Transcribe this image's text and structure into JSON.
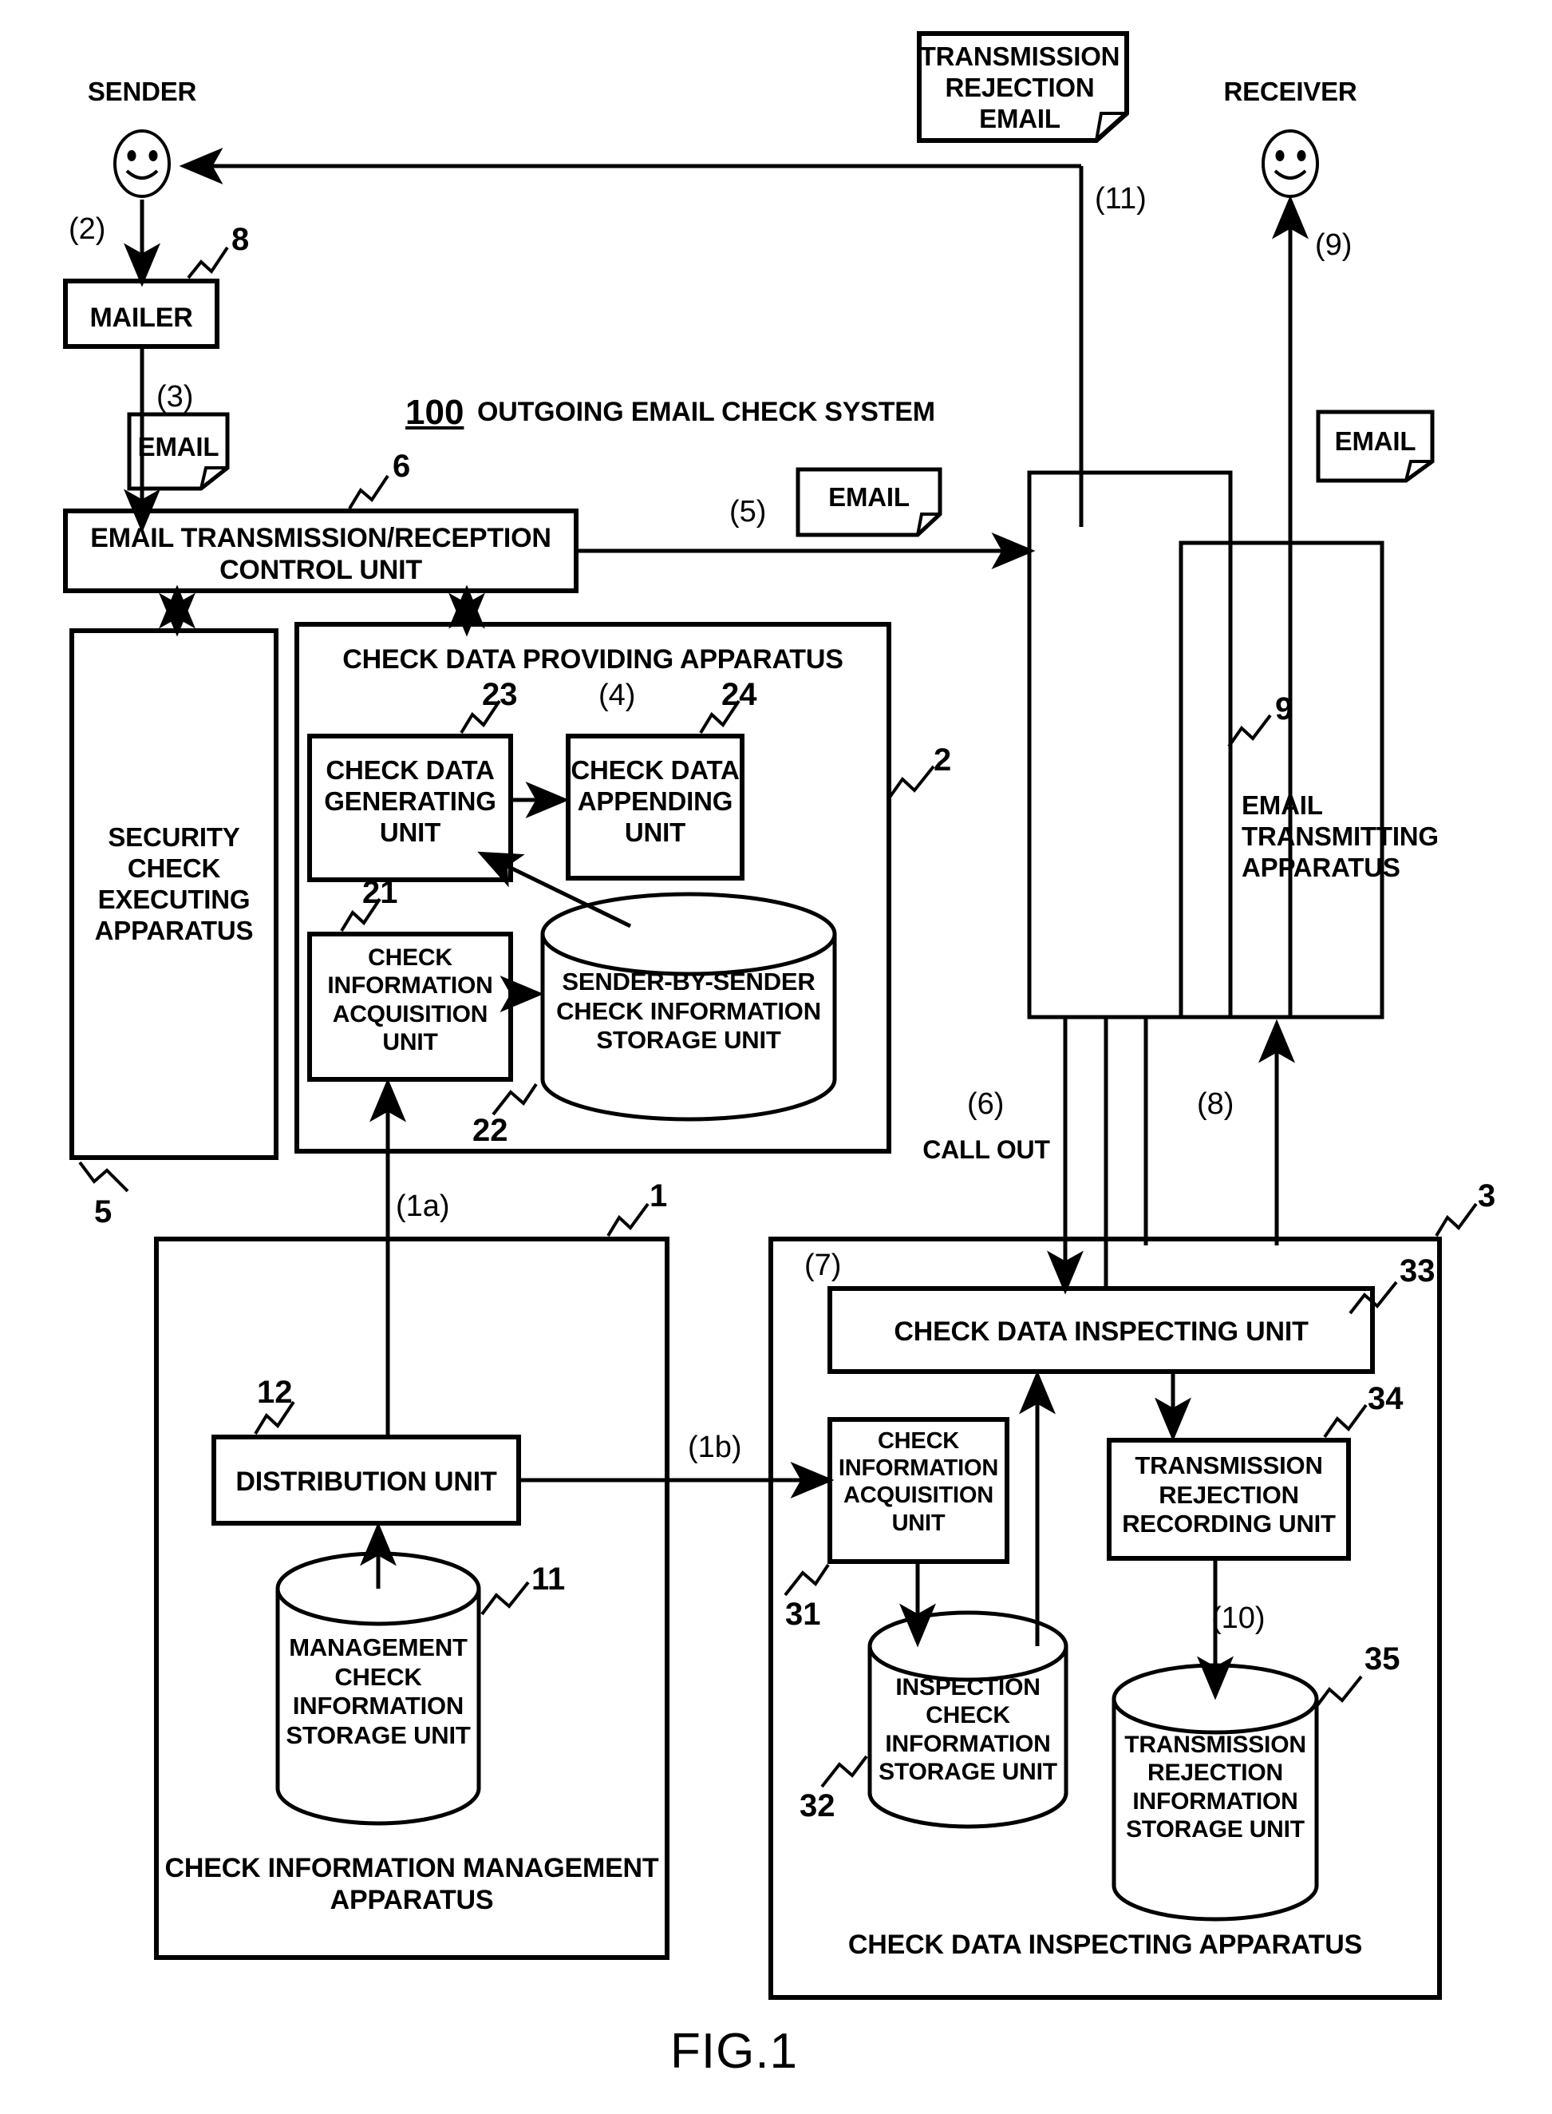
{
  "figure": {
    "caption": "FIG.1",
    "system_number": "100",
    "system_title": "OUTGOING EMAIL CHECK SYSTEM"
  },
  "actors": {
    "sender": "SENDER",
    "receiver": "RECEIVER"
  },
  "documents": {
    "transmission_rejection_email": "TRANSMISSION\nREJECTION\nEMAIL",
    "email_from_mailer": "EMAIL",
    "email_step5": "EMAIL",
    "email_to_receiver": "EMAIL"
  },
  "blocks": {
    "mailer": {
      "label": "MAILER",
      "ref": "8"
    },
    "email_control_unit": {
      "label": "EMAIL TRANSMISSION/RECEPTION\nCONTROL UNIT",
      "ref": "6"
    },
    "security_check_apparatus": {
      "label": "SECURITY\nCHECK\nEXECUTING\nAPPARATUS",
      "ref": "5"
    },
    "check_data_providing_apparatus": {
      "label": "CHECK DATA PROVIDING APPARATUS",
      "ref": "2"
    },
    "check_data_generating_unit": {
      "label": "CHECK DATA\nGENERATING\nUNIT",
      "ref": "23"
    },
    "check_data_appending_unit": {
      "label": "CHECK DATA\nAPPENDING\nUNIT",
      "ref": "24"
    },
    "check_information_acquisition_unit_2": {
      "label": "CHECK\nINFORMATION\nACQUISITION\nUNIT",
      "ref": "21"
    },
    "sender_by_sender_storage": {
      "label": "SENDER-BY-SENDER\nCHECK INFORMATION\nSTORAGE UNIT",
      "ref": "22"
    },
    "email_transmitting_apparatus": {
      "label": "EMAIL\nTRANSMITTING\nAPPARATUS",
      "ref": "9"
    },
    "check_information_management_apparatus": {
      "label": "CHECK INFORMATION MANAGEMENT\nAPPARATUS",
      "ref": "1"
    },
    "distribution_unit": {
      "label": "DISTRIBUTION UNIT",
      "ref": "12"
    },
    "management_check_storage": {
      "label": "MANAGEMENT\nCHECK\nINFORMATION\nSTORAGE UNIT",
      "ref": "11"
    },
    "check_data_inspecting_apparatus": {
      "label": "CHECK DATA INSPECTING APPARATUS",
      "ref": "3"
    },
    "check_data_inspecting_unit": {
      "label": "CHECK DATA INSPECTING UNIT",
      "ref": "33"
    },
    "check_information_acquisition_unit_3": {
      "label": "CHECK\nINFORMATION\nACQUISITION\nUNIT",
      "ref": "31"
    },
    "inspection_check_storage": {
      "label": "INSPECTION\nCHECK\nINFORMATION\nSTORAGE UNIT",
      "ref": "32"
    },
    "transmission_rejection_recording_unit": {
      "label": "TRANSMISSION\nREJECTION\nRECORDING UNIT",
      "ref": "34"
    },
    "transmission_rejection_storage": {
      "label": "TRANSMISSION\nREJECTION\nINFORMATION\nSTORAGE UNIT",
      "ref": "35"
    }
  },
  "steps": {
    "s1a": "(1a)",
    "s1b": "(1b)",
    "s2": "(2)",
    "s3": "(3)",
    "s4": "(4)",
    "s5": "(5)",
    "s6": "(6)",
    "s6_note": "CALL OUT",
    "s7": "(7)",
    "s8": "(8)",
    "s9": "(9)",
    "s10": "(10)",
    "s11": "(11)"
  },
  "colors": {
    "stroke": "#000000",
    "background": "#ffffff"
  }
}
